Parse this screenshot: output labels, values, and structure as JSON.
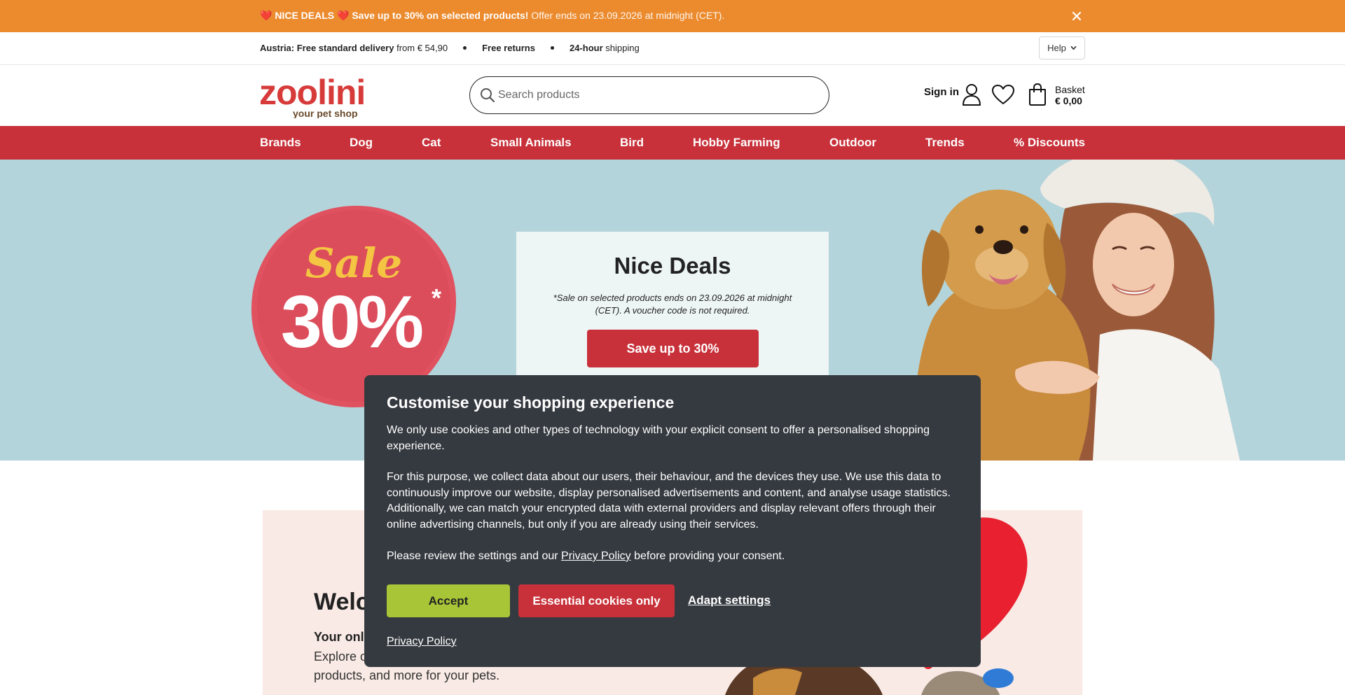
{
  "colors": {
    "promo_bg": "#ec8b2e",
    "brand_red": "#c8313a",
    "hero_bg": "#b3d4da",
    "accept_green": "#a7c537",
    "modal_bg": "#353a40",
    "welcome_bg": "#f9eae5"
  },
  "promo": {
    "heart_icon": "red-heart",
    "bold_text": "NICE DEALS",
    "offer": "Save up to 30% on selected products!",
    "ends": "Offer ends on 23.09.2026 at midnight (CET).",
    "close_icon": "close-x"
  },
  "usp": {
    "delivery_bold": "Austria: Free standard delivery",
    "delivery_rest": "from € 54,90",
    "returns": "Free returns",
    "shipping_bold": "24-hour",
    "shipping_rest": "shipping",
    "help_label": "Help"
  },
  "header": {
    "logo_text": "zoolini",
    "logo_tagline": "your pet shop",
    "search_placeholder": "Search products",
    "sign_in": "Sign in",
    "basket_label": "Basket",
    "basket_total": "€ 0,00"
  },
  "nav": {
    "items": [
      "Brands",
      "Dog",
      "Cat",
      "Small Animals",
      "Bird",
      "Hobby Farming",
      "Outdoor",
      "Trends",
      "% Discounts"
    ]
  },
  "hero": {
    "sale_word": "Sale",
    "sale_percent": "30%",
    "sale_asterisk": "*",
    "title": "Nice Deals",
    "note": "*Sale on selected products ends on 23.09.2026 at midnight (CET). A voucher code is not required.",
    "button": "Save up to 30%"
  },
  "welcome": {
    "title": "Welc",
    "subtitle": "Your onl",
    "body_line1": "Explore o",
    "body_line2": "products, and more for your pets."
  },
  "cookie": {
    "title": "Customise your shopping experience",
    "p1": "We only use cookies and other types of technology with your explicit consent to offer a personalised shopping experience.",
    "p2": "For this purpose, we collect data about our users, their behaviour, and the devices they use. We use this data to continuously improve our website, display personalised advertisements and content, and analyse usage statistics. Additionally, we can match your encrypted data with external providers and display relevant offers through their online advertising channels, but only if you are already using their services.",
    "p3_before": "Please review the settings and our",
    "p3_link": "Privacy Policy",
    "p3_after": "before providing your consent.",
    "accept": "Accept",
    "essential": "Essential cookies only",
    "adapt": "Adapt settings",
    "privacy": "Privacy Policy"
  }
}
